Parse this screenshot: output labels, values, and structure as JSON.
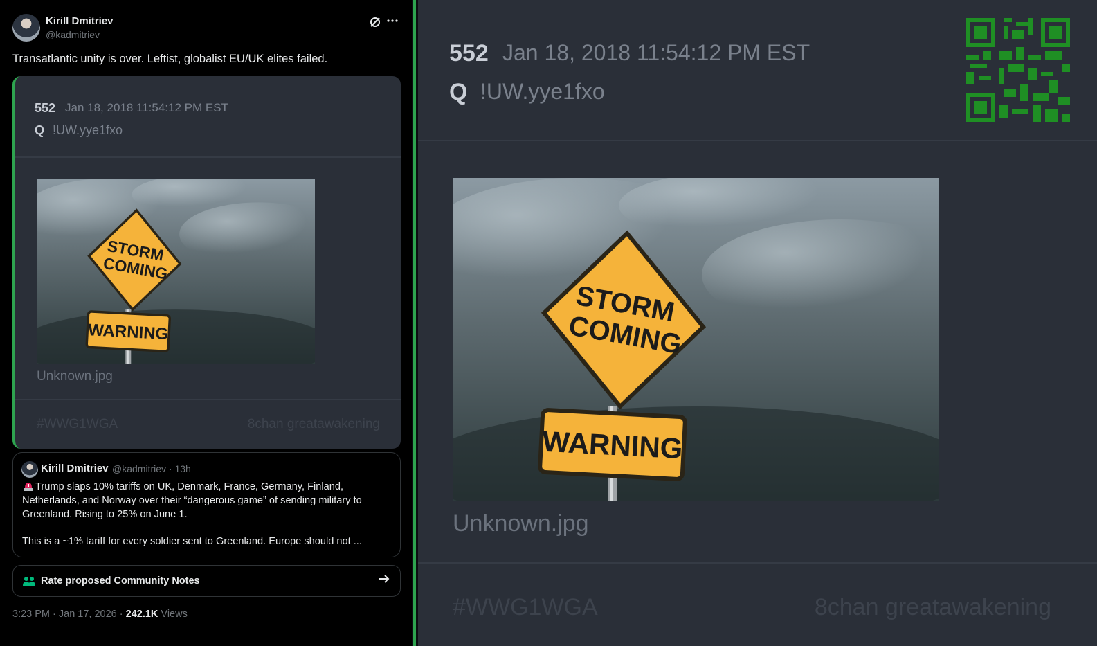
{
  "tweet": {
    "author_name": "Kirill Dmitriev",
    "author_handle": "@kadmitriev",
    "text": "Transatlantic unity is over. Leftist, globalist EU/UK elites failed.",
    "embed": {
      "post_number": "552",
      "date": "Jan 18, 2018 11:54:12 PM EST",
      "q_label": "Q",
      "tripcode": "!UW.yye1fxo",
      "file_name": "Unknown.jpg",
      "hashtag": "#WWG1WGA",
      "source": "8chan greatawakening"
    },
    "quote": {
      "author_name": "Kirill Dmitriev",
      "author_meta": "@kadmitriev · 13h",
      "text": "Trump slaps 10% tariffs on UK, Denmark, France, Germany, Finland, Netherlands, and Norway over their “dangerous game” of sending military to Greenland. Rising to 25% on June 1.",
      "text2": "This is a ~1% tariff for every soldier sent to Greenland. Europe should not ..."
    },
    "community_notes_label": "Rate proposed Community Notes",
    "timestamp": "3:23 PM · Jan 17, 2026 · ",
    "views_count": "242.1K",
    "views_label": " Views"
  },
  "image": {
    "sign_top_line1": "STORM",
    "sign_top_line2": "COMING",
    "sign_bottom": "WARNING"
  },
  "post": {
    "post_number": "552",
    "date": "Jan 18, 2018 11:54:12 PM EST",
    "q_label": "Q",
    "tripcode": "!UW.yye1fxo",
    "file_name": "Unknown.jpg",
    "hashtag": "#WWG1WGA",
    "source": "8chan greatawakening"
  },
  "icons": {
    "grok": "grok-icon",
    "more": "more-icon",
    "alert": "siren-icon",
    "notes": "community-notes-icon",
    "arrow": "arrow-right-icon",
    "qr": "qr-code-icon"
  },
  "colors": {
    "accent_green": "#2ea44f",
    "qr_green": "#1f8f24",
    "panel_bg": "#2a2f38",
    "tweet_bg": "#000000",
    "sign_yellow": "#f5b33a"
  }
}
